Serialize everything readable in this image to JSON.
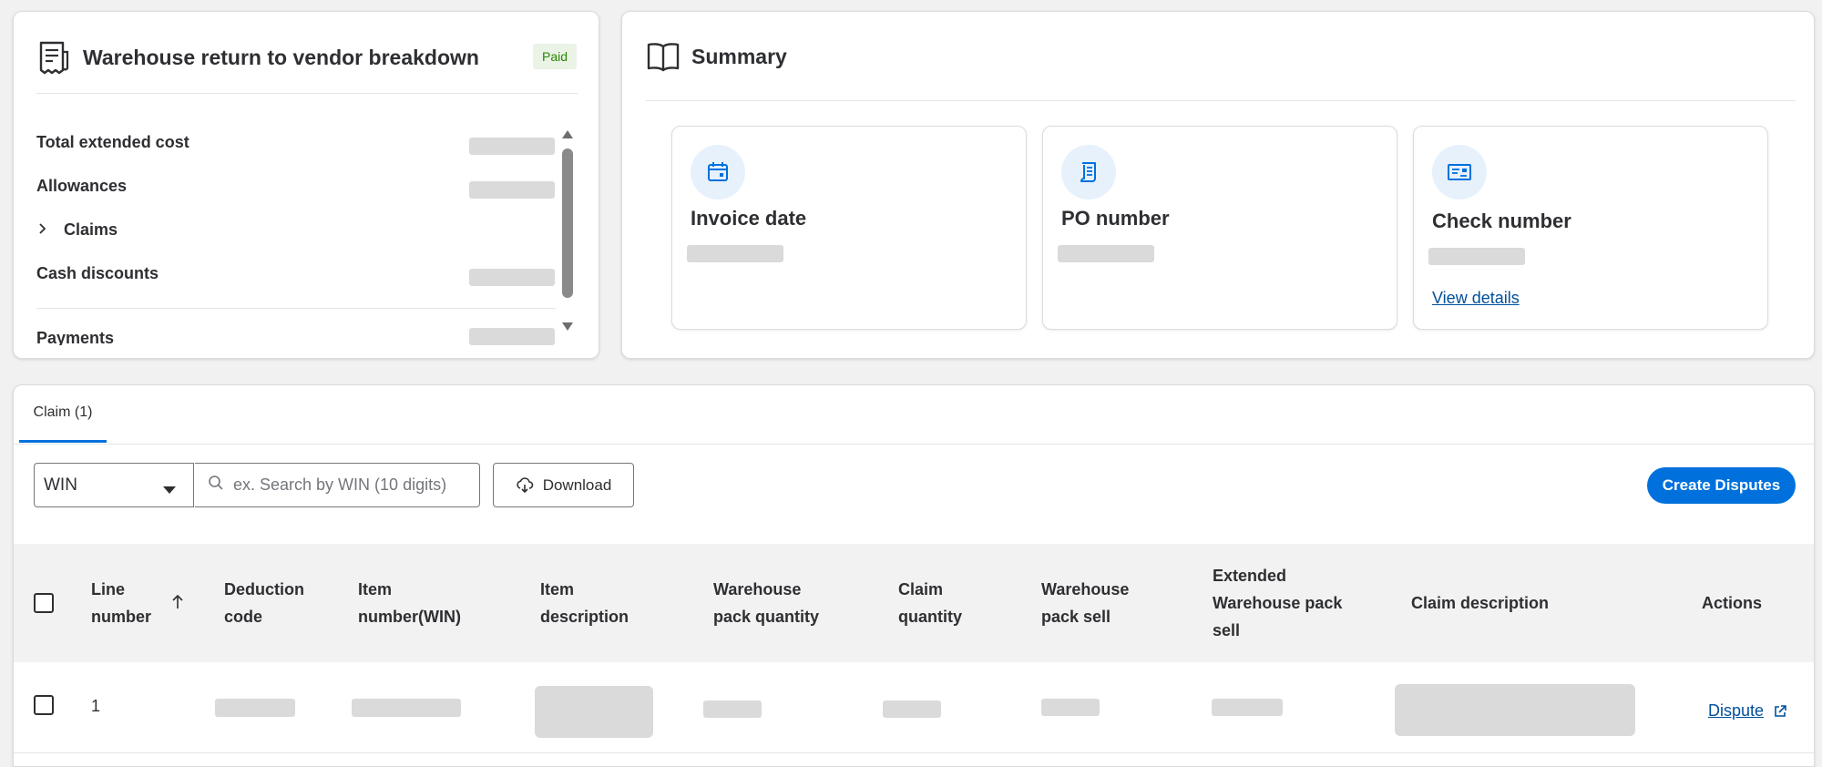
{
  "breakdown": {
    "title": "Warehouse return to vendor breakdown",
    "status": "Paid",
    "rows": [
      {
        "label": "Total extended cost"
      },
      {
        "label": "Allowances"
      },
      {
        "label": "Claims"
      },
      {
        "label": "Cash discounts"
      },
      {
        "label": "Payments"
      }
    ]
  },
  "summary": {
    "title": "Summary",
    "cards": [
      {
        "label": "Invoice date",
        "icon": "calendar-icon"
      },
      {
        "label": "PO number",
        "icon": "document-icon"
      },
      {
        "label": "Check number",
        "icon": "check-icon",
        "link": "View details"
      }
    ]
  },
  "claims": {
    "tab_label": "Claim (1)",
    "filter_value": "WIN",
    "search_placeholder": "ex. Search by WIN (10 digits)",
    "download_label": "Download",
    "create_label": "Create Disputes",
    "columns": [
      "Line number",
      "Deduction code",
      "Item number(WIN)",
      "Item description",
      "Warehouse pack quantity",
      "Claim quantity",
      "Warehouse pack sell",
      "Extended Warehouse pack sell",
      "Claim description",
      "Actions"
    ],
    "rows": [
      {
        "line_number": "1",
        "action": "Dispute"
      }
    ]
  },
  "colors": {
    "accent": "#0071dc",
    "link": "#004f9a",
    "paid_bg": "#eaf3e6",
    "paid_text": "#2a8703"
  }
}
